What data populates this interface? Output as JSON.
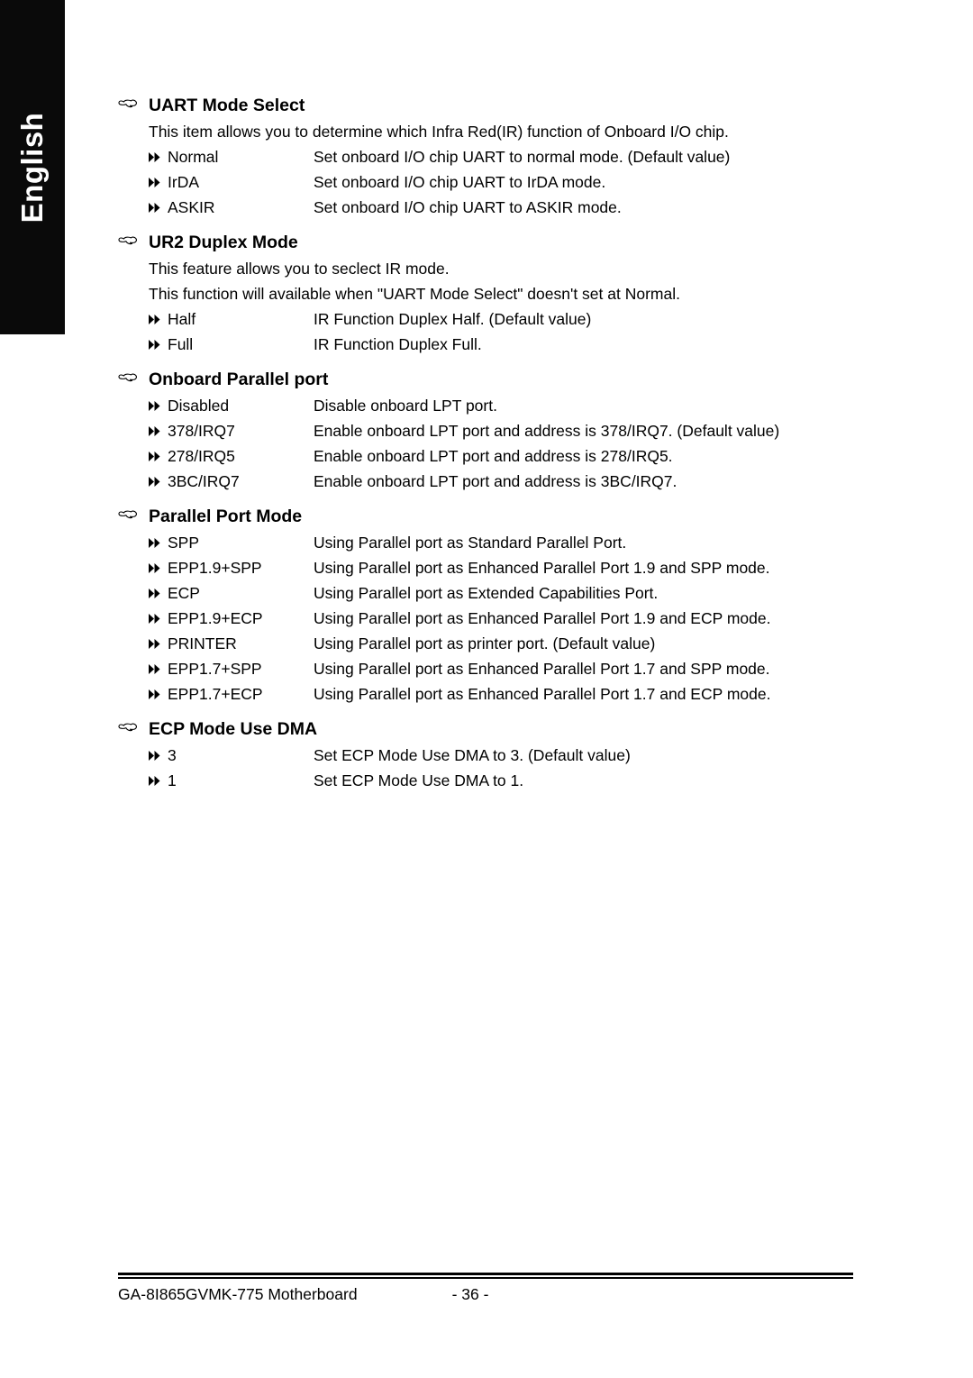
{
  "page": {
    "language_tab": "English",
    "hand_icon": "pointing-hand-icon",
    "bullet_icon": "double-triangle-right-icon"
  },
  "sections": [
    {
      "heading": "UART Mode Select",
      "paragraphs": [
        "This item allows you to determine which Infra Red(IR) function of Onboard I/O chip."
      ],
      "options": [
        {
          "name": "Normal",
          "desc": "Set onboard I/O chip UART to normal mode. (Default value)"
        },
        {
          "name": "IrDA",
          "desc": "Set onboard I/O chip UART to IrDA mode."
        },
        {
          "name": "ASKIR",
          "desc": "Set onboard I/O chip UART to ASKIR mode."
        }
      ]
    },
    {
      "heading": "UR2 Duplex Mode",
      "paragraphs": [
        "This feature allows you to seclect IR mode.",
        "This function will available when \"UART Mode Select\" doesn't set at Normal."
      ],
      "options": [
        {
          "name": "Half",
          "desc": "IR Function Duplex Half. (Default value)"
        },
        {
          "name": "Full",
          "desc": "IR Function Duplex Full."
        }
      ]
    },
    {
      "heading": "Onboard Parallel port",
      "paragraphs": [],
      "options": [
        {
          "name": "Disabled",
          "desc": "Disable onboard LPT port."
        },
        {
          "name": "378/IRQ7",
          "desc": "Enable onboard LPT port and address is 378/IRQ7. (Default value)"
        },
        {
          "name": "278/IRQ5",
          "desc": "Enable onboard LPT port and address is 278/IRQ5."
        },
        {
          "name": "3BC/IRQ7",
          "desc": "Enable onboard LPT port and address is 3BC/IRQ7."
        }
      ]
    },
    {
      "heading": "Parallel Port Mode",
      "paragraphs": [],
      "options": [
        {
          "name": "SPP",
          "desc": "Using Parallel port as Standard Parallel Port."
        },
        {
          "name": "EPP1.9+SPP",
          "desc": "Using Parallel port as Enhanced Parallel Port 1.9 and SPP mode."
        },
        {
          "name": "ECP",
          "desc": "Using Parallel port as Extended Capabilities Port."
        },
        {
          "name": "EPP1.9+ECP",
          "desc": "Using Parallel port as Enhanced Parallel Port 1.9 and ECP mode."
        },
        {
          "name": "PRINTER",
          "desc": "Using Parallel port as printer port. (Default value)"
        },
        {
          "name": "EPP1.7+SPP",
          "desc": "Using Parallel port as Enhanced Parallel Port 1.7 and SPP mode."
        },
        {
          "name": "EPP1.7+ECP",
          "desc": "Using Parallel port as Enhanced Parallel Port 1.7 and ECP mode."
        }
      ]
    },
    {
      "heading": "ECP Mode Use DMA",
      "paragraphs": [],
      "options": [
        {
          "name": "3",
          "desc": "Set ECP Mode Use DMA to 3. (Default value)"
        },
        {
          "name": "1",
          "desc": "Set ECP Mode Use DMA to 1."
        }
      ]
    }
  ],
  "footer": {
    "product": "GA-8I865GVMK-775 Motherboard",
    "page_number": "- 36 -"
  }
}
